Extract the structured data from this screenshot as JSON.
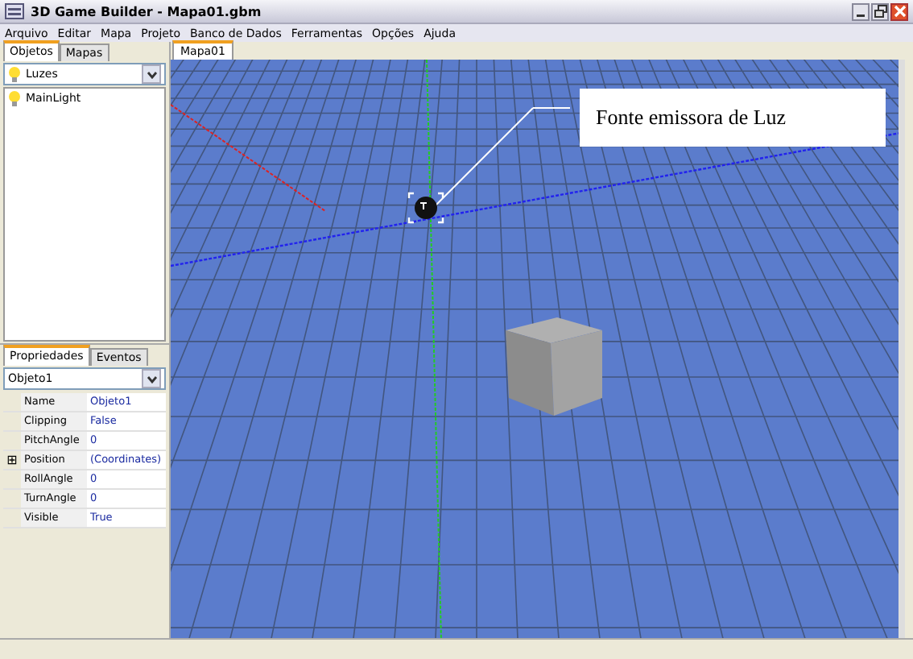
{
  "window": {
    "title": "3D Game Builder - Mapa01.gbm"
  },
  "menu": [
    "Arquivo",
    "Editar",
    "Mapa",
    "Projeto",
    "Banco de Dados",
    "Ferramentas",
    "Opções",
    "Ajuda"
  ],
  "left_tabs": [
    {
      "label": "Objetos",
      "selected": true
    },
    {
      "label": "Mapas",
      "selected": false
    }
  ],
  "object_filter": {
    "value": "Luzes"
  },
  "objects": [
    {
      "label": "MainLight",
      "selected": false
    }
  ],
  "property_tabs": [
    {
      "label": "Propriedades",
      "selected": true
    },
    {
      "label": "Eventos",
      "selected": false
    }
  ],
  "object_select": {
    "value": "Objeto1"
  },
  "properties": [
    {
      "name": "Name",
      "value": "Objeto1"
    },
    {
      "name": "Clipping",
      "value": "False"
    },
    {
      "name": "PitchAngle",
      "value": "0"
    },
    {
      "name": "Position",
      "value": "(Coordinates)",
      "expander": "⊞"
    },
    {
      "name": "RollAngle",
      "value": "0"
    },
    {
      "name": "TurnAngle",
      "value": "0"
    },
    {
      "name": "Visible",
      "value": "True"
    }
  ],
  "doc_tabs": [
    {
      "label": "Mapa01",
      "selected": true
    }
  ],
  "callout": {
    "text": "Fonte emissora de Luz"
  }
}
